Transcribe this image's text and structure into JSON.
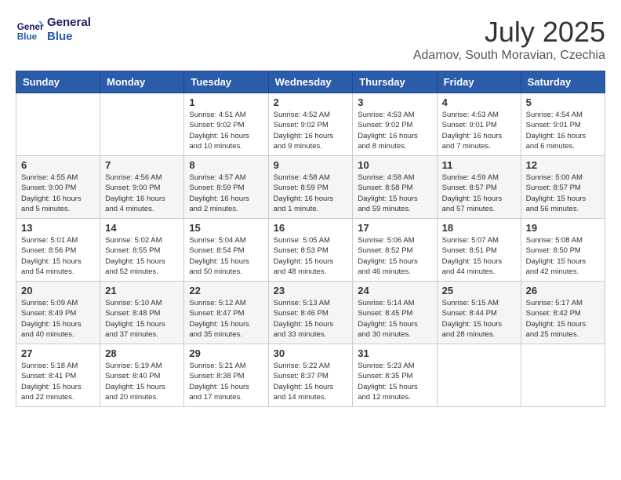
{
  "header": {
    "logo_line1": "General",
    "logo_line2": "Blue",
    "month": "July 2025",
    "location": "Adamov, South Moravian, Czechia"
  },
  "weekdays": [
    "Sunday",
    "Monday",
    "Tuesday",
    "Wednesday",
    "Thursday",
    "Friday",
    "Saturday"
  ],
  "weeks": [
    [
      {
        "day": "",
        "info": ""
      },
      {
        "day": "",
        "info": ""
      },
      {
        "day": "1",
        "info": "Sunrise: 4:51 AM\nSunset: 9:02 PM\nDaylight: 16 hours and 10 minutes."
      },
      {
        "day": "2",
        "info": "Sunrise: 4:52 AM\nSunset: 9:02 PM\nDaylight: 16 hours and 9 minutes."
      },
      {
        "day": "3",
        "info": "Sunrise: 4:53 AM\nSunset: 9:02 PM\nDaylight: 16 hours and 8 minutes."
      },
      {
        "day": "4",
        "info": "Sunrise: 4:53 AM\nSunset: 9:01 PM\nDaylight: 16 hours and 7 minutes."
      },
      {
        "day": "5",
        "info": "Sunrise: 4:54 AM\nSunset: 9:01 PM\nDaylight: 16 hours and 6 minutes."
      }
    ],
    [
      {
        "day": "6",
        "info": "Sunrise: 4:55 AM\nSunset: 9:00 PM\nDaylight: 16 hours and 5 minutes."
      },
      {
        "day": "7",
        "info": "Sunrise: 4:56 AM\nSunset: 9:00 PM\nDaylight: 16 hours and 4 minutes."
      },
      {
        "day": "8",
        "info": "Sunrise: 4:57 AM\nSunset: 8:59 PM\nDaylight: 16 hours and 2 minutes."
      },
      {
        "day": "9",
        "info": "Sunrise: 4:58 AM\nSunset: 8:59 PM\nDaylight: 16 hours and 1 minute."
      },
      {
        "day": "10",
        "info": "Sunrise: 4:58 AM\nSunset: 8:58 PM\nDaylight: 15 hours and 59 minutes."
      },
      {
        "day": "11",
        "info": "Sunrise: 4:59 AM\nSunset: 8:57 PM\nDaylight: 15 hours and 57 minutes."
      },
      {
        "day": "12",
        "info": "Sunrise: 5:00 AM\nSunset: 8:57 PM\nDaylight: 15 hours and 56 minutes."
      }
    ],
    [
      {
        "day": "13",
        "info": "Sunrise: 5:01 AM\nSunset: 8:56 PM\nDaylight: 15 hours and 54 minutes."
      },
      {
        "day": "14",
        "info": "Sunrise: 5:02 AM\nSunset: 8:55 PM\nDaylight: 15 hours and 52 minutes."
      },
      {
        "day": "15",
        "info": "Sunrise: 5:04 AM\nSunset: 8:54 PM\nDaylight: 15 hours and 50 minutes."
      },
      {
        "day": "16",
        "info": "Sunrise: 5:05 AM\nSunset: 8:53 PM\nDaylight: 15 hours and 48 minutes."
      },
      {
        "day": "17",
        "info": "Sunrise: 5:06 AM\nSunset: 8:52 PM\nDaylight: 15 hours and 46 minutes."
      },
      {
        "day": "18",
        "info": "Sunrise: 5:07 AM\nSunset: 8:51 PM\nDaylight: 15 hours and 44 minutes."
      },
      {
        "day": "19",
        "info": "Sunrise: 5:08 AM\nSunset: 8:50 PM\nDaylight: 15 hours and 42 minutes."
      }
    ],
    [
      {
        "day": "20",
        "info": "Sunrise: 5:09 AM\nSunset: 8:49 PM\nDaylight: 15 hours and 40 minutes."
      },
      {
        "day": "21",
        "info": "Sunrise: 5:10 AM\nSunset: 8:48 PM\nDaylight: 15 hours and 37 minutes."
      },
      {
        "day": "22",
        "info": "Sunrise: 5:12 AM\nSunset: 8:47 PM\nDaylight: 15 hours and 35 minutes."
      },
      {
        "day": "23",
        "info": "Sunrise: 5:13 AM\nSunset: 8:46 PM\nDaylight: 15 hours and 33 minutes."
      },
      {
        "day": "24",
        "info": "Sunrise: 5:14 AM\nSunset: 8:45 PM\nDaylight: 15 hours and 30 minutes."
      },
      {
        "day": "25",
        "info": "Sunrise: 5:15 AM\nSunset: 8:44 PM\nDaylight: 15 hours and 28 minutes."
      },
      {
        "day": "26",
        "info": "Sunrise: 5:17 AM\nSunset: 8:42 PM\nDaylight: 15 hours and 25 minutes."
      }
    ],
    [
      {
        "day": "27",
        "info": "Sunrise: 5:18 AM\nSunset: 8:41 PM\nDaylight: 15 hours and 22 minutes."
      },
      {
        "day": "28",
        "info": "Sunrise: 5:19 AM\nSunset: 8:40 PM\nDaylight: 15 hours and 20 minutes."
      },
      {
        "day": "29",
        "info": "Sunrise: 5:21 AM\nSunset: 8:38 PM\nDaylight: 15 hours and 17 minutes."
      },
      {
        "day": "30",
        "info": "Sunrise: 5:22 AM\nSunset: 8:37 PM\nDaylight: 15 hours and 14 minutes."
      },
      {
        "day": "31",
        "info": "Sunrise: 5:23 AM\nSunset: 8:35 PM\nDaylight: 15 hours and 12 minutes."
      },
      {
        "day": "",
        "info": ""
      },
      {
        "day": "",
        "info": ""
      }
    ]
  ]
}
